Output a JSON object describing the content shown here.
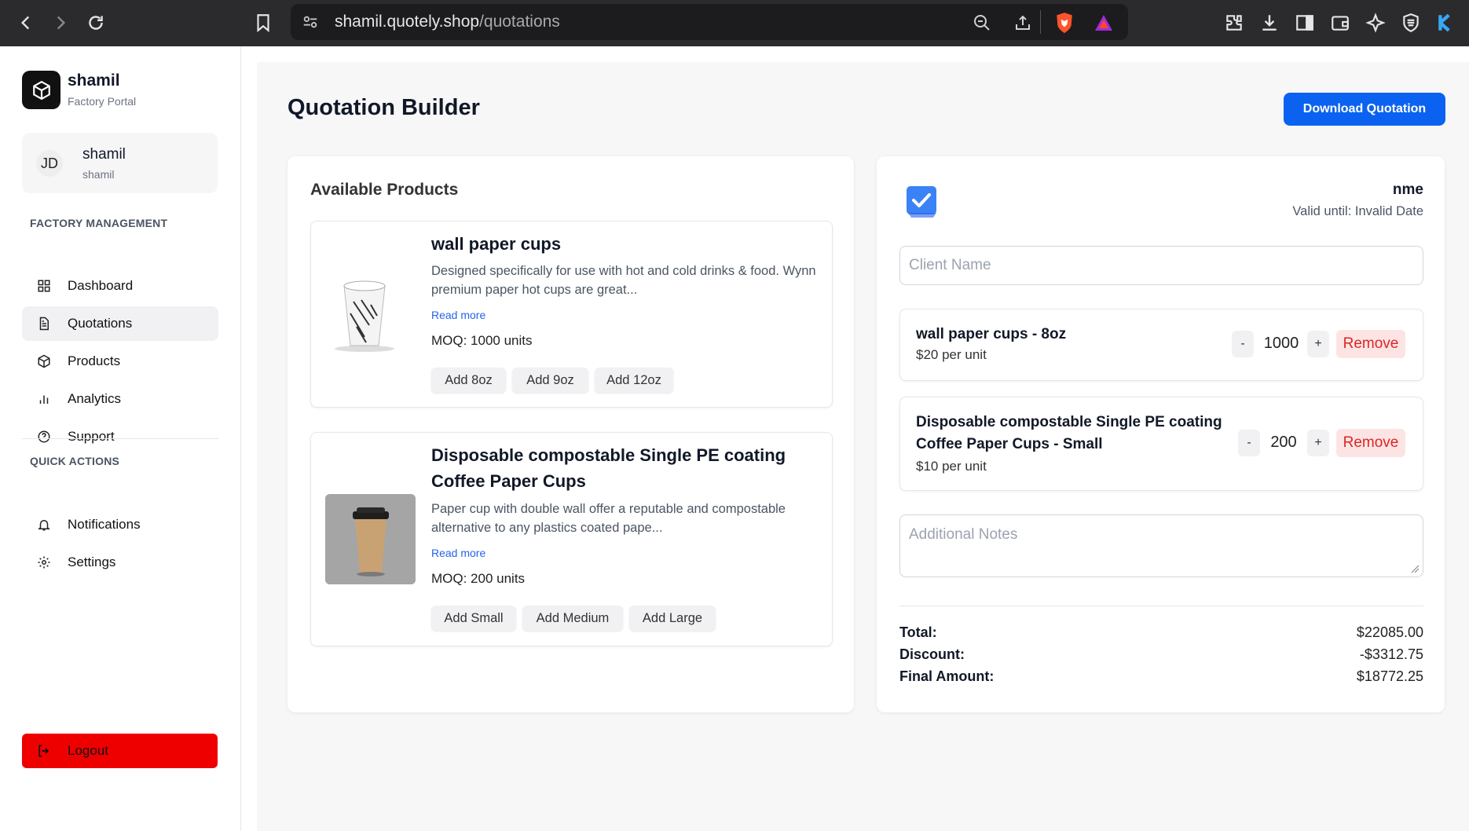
{
  "browser": {
    "url_domain": "shamil.quotely.shop",
    "url_path": "/quotations"
  },
  "sidebar": {
    "brand": "shamil",
    "brand_sub": "Factory Portal",
    "user": {
      "initials": "JD",
      "name": "shamil",
      "sub": "shamil"
    },
    "section1": "FACTORY MANAGEMENT",
    "nav": [
      {
        "label": "Dashboard",
        "icon": "dashboard-icon"
      },
      {
        "label": "Quotations",
        "icon": "document-icon",
        "active": true
      },
      {
        "label": "Products",
        "icon": "cube-icon"
      },
      {
        "label": "Analytics",
        "icon": "bar-chart-icon"
      },
      {
        "label": "Support",
        "icon": "help-circle-icon"
      }
    ],
    "section2": "QUICK ACTIONS",
    "quick": [
      {
        "label": "Notifications",
        "icon": "bell-icon"
      },
      {
        "label": "Settings",
        "icon": "gear-icon"
      }
    ],
    "logout": "Logout"
  },
  "header": {
    "title": "Quotation Builder",
    "download": "Download Quotation"
  },
  "products": {
    "heading": "Available Products",
    "items": [
      {
        "name": "wall paper cups",
        "desc": "Designed specifically for use with hot and cold drinks & food. Wynn premium paper hot cups are great...",
        "read_more": "Read more",
        "moq": "MOQ: 1000 units",
        "buttons": [
          "Add 8oz",
          "Add 9oz",
          "Add 12oz"
        ]
      },
      {
        "name": "Disposable compostable Single PE coating Coffee Paper Cups",
        "desc": "Paper cup with double wall offer a reputable and compostable alternative to any plastics coated pape...",
        "read_more": "Read more",
        "moq": "MOQ: 200 units",
        "buttons": [
          "Add Small",
          "Add Medium",
          "Add Large"
        ]
      }
    ]
  },
  "quote": {
    "company": "nme",
    "valid": "Valid until: Invalid Date",
    "client_placeholder": "Client Name",
    "items": [
      {
        "name": "wall paper cups - 8oz",
        "price": "$20 per unit",
        "qty": "1000",
        "minus": "-",
        "plus": "+",
        "remove": "Remove"
      },
      {
        "name": "Disposable compostable Single PE coating Coffee Paper Cups - Small",
        "price": "$10 per unit",
        "qty": "200",
        "minus": "-",
        "plus": "+",
        "remove": "Remove"
      }
    ],
    "notes_placeholder": "Additional Notes",
    "totals": {
      "total_label": "Total:",
      "total": "$22085.00",
      "discount_label": "Discount:",
      "discount": "-$3312.75",
      "final_label": "Final Amount:",
      "final": "$18772.25"
    }
  }
}
